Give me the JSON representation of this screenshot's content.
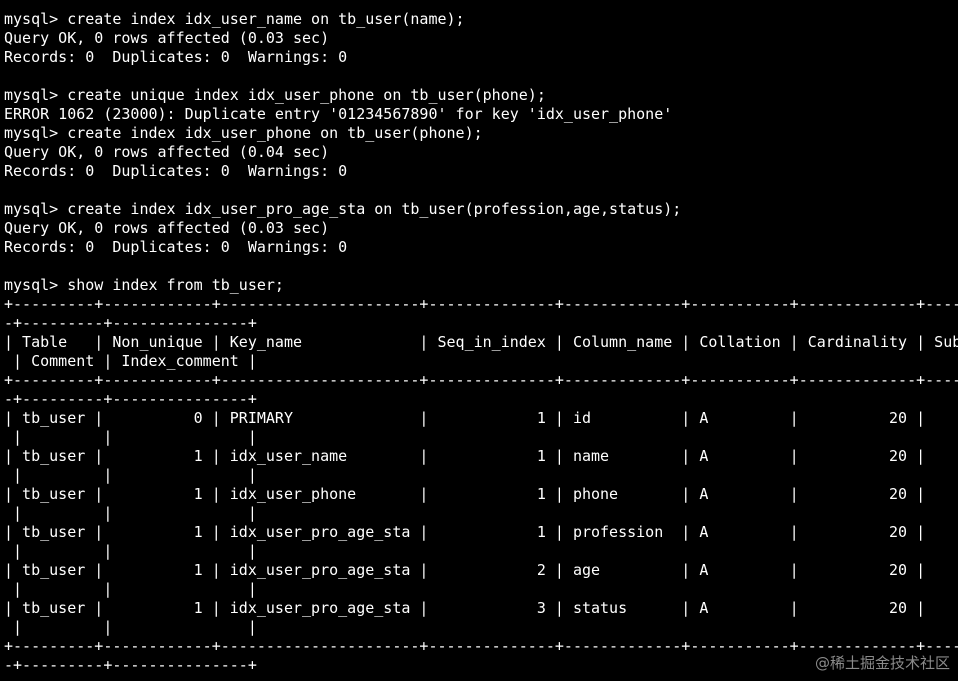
{
  "terminal": {
    "lines": [
      "mysql> create index idx_user_name on tb_user(name);",
      "Query OK, 0 rows affected (0.03 sec)",
      "Records: 0  Duplicates: 0  Warnings: 0",
      "",
      "mysql> create unique index idx_user_phone on tb_user(phone);",
      "ERROR 1062 (23000): Duplicate entry '01234567890' for key 'idx_user_phone'",
      "mysql> create index idx_user_phone on tb_user(phone);",
      "Query OK, 0 rows affected (0.04 sec)",
      "Records: 0  Duplicates: 0  Warnings: 0",
      "",
      "mysql> create index idx_user_pro_age_sta on tb_user(profession,age,status);",
      "Query OK, 0 rows affected (0.03 sec)",
      "Records: 0  Duplicates: 0  Warnings: 0",
      "",
      "mysql> show index from tb_user;",
      "+---------+------------+----------------------+--------------+-------------+-----------+-------------+----",
      "-+---------+---------------+",
      "| Table   | Non_unique | Key_name             | Seq_in_index | Column_name | Collation | Cardinality | Sub",
      " | Comment | Index_comment |",
      "+---------+------------+----------------------+--------------+-------------+-----------+-------------+----",
      "-+---------+---------------+",
      "| tb_user |          0 | PRIMARY              |            1 | id          | A         |          20 |",
      " |         |               |",
      "| tb_user |          1 | idx_user_name        |            1 | name        | A         |          20 |",
      " |         |               |",
      "| tb_user |          1 | idx_user_phone       |            1 | phone       | A         |          20 |",
      " |         |               |",
      "| tb_user |          1 | idx_user_pro_age_sta |            1 | profession  | A         |          20 |",
      " |         |               |",
      "| tb_user |          1 | idx_user_pro_age_sta |            2 | age         | A         |          20 |",
      " |         |               |",
      "| tb_user |          1 | idx_user_pro_age_sta |            3 | status      | A         |          20 |",
      " |         |               |",
      "+---------+------------+----------------------+--------------+-------------+-----------+-------------+----",
      "-+---------+---------------+"
    ]
  },
  "watermark": {
    "text": "@稀土掘金技术社区"
  }
}
